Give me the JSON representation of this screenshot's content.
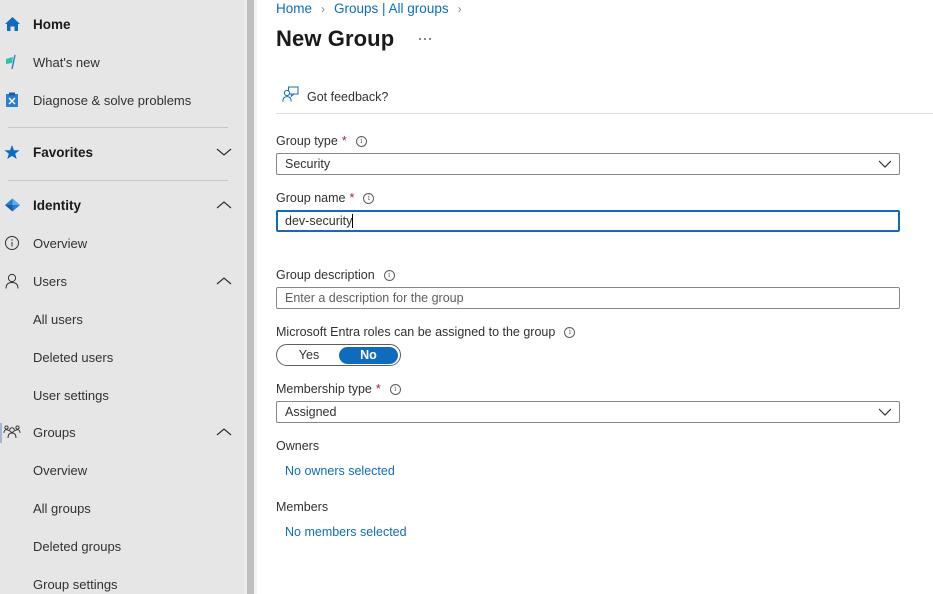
{
  "sidebar": {
    "items": [
      {
        "label": "Home",
        "icon": "home-icon"
      },
      {
        "label": "What's new",
        "icon": "flag-icon"
      },
      {
        "label": "Diagnose & solve problems",
        "icon": "wrench-clipboard-icon"
      },
      {
        "label": "Favorites",
        "icon": "star-icon",
        "expanded": false
      },
      {
        "label": "Identity",
        "icon": "identity-diamond-icon",
        "expanded": true
      },
      {
        "label": "Overview",
        "icon": "info-icon"
      },
      {
        "label": "Users",
        "icon": "person-icon",
        "expanded": true
      },
      {
        "label": "All users"
      },
      {
        "label": "Deleted users"
      },
      {
        "label": "User settings"
      },
      {
        "label": "Groups",
        "icon": "groups-icon",
        "expanded": true
      },
      {
        "label": "Overview"
      },
      {
        "label": "All groups"
      },
      {
        "label": "Deleted groups"
      },
      {
        "label": "Group settings"
      }
    ]
  },
  "breadcrumb": {
    "items": [
      "Home",
      "Groups | All groups"
    ]
  },
  "page": {
    "title": "New Group",
    "more_label": "More options"
  },
  "toolbar": {
    "feedback_label": "Got feedback?"
  },
  "form": {
    "required_mark": "*",
    "group_type": {
      "label": "Group type",
      "value": "Security"
    },
    "group_name": {
      "label": "Group name",
      "value": "dev-security"
    },
    "group_description": {
      "label": "Group description",
      "placeholder": "Enter a description for the group",
      "value": ""
    },
    "entra_roles": {
      "label": "Microsoft Entra roles can be assigned to the group",
      "options": [
        "Yes",
        "No"
      ],
      "selected": "No"
    },
    "membership_type": {
      "label": "Membership type",
      "value": "Assigned"
    },
    "owners": {
      "label": "Owners",
      "link": "No owners selected"
    },
    "members": {
      "label": "Members",
      "link": "No members selected"
    }
  },
  "colors": {
    "accent": "#0f6cbd",
    "required": "#a4262c",
    "sidebar_bg": "#e6e6e6"
  }
}
